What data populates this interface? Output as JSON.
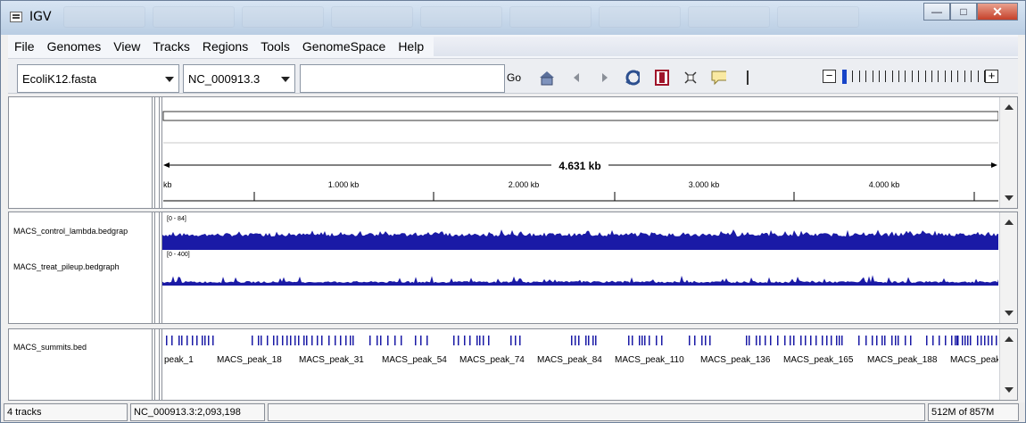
{
  "window": {
    "title": "IGV"
  },
  "menu": [
    "File",
    "Genomes",
    "View",
    "Tracks",
    "Regions",
    "Tools",
    "GenomeSpace",
    "Help"
  ],
  "toolbar": {
    "genome": "EcoliK12.fasta",
    "chromosome": "NC_000913.3",
    "locus": "",
    "go_label": "Go"
  },
  "ruler": {
    "span_label": "4.631 kb",
    "ticks": [
      "kb",
      "1.000 kb",
      "2.000 kb",
      "3.000 kb",
      "4.000 kb"
    ]
  },
  "tracks": [
    {
      "name": "MACS_control_lambda.bedgrap",
      "range": "[0 - 84]"
    },
    {
      "name": "MACS_treat_pileup.bedgraph",
      "range": "[0 - 400]"
    }
  ],
  "feature_track": {
    "name": "MACS_summits.bed",
    "labels": [
      "peak_1",
      "MACS_peak_18",
      "MACS_peak_31",
      "MACS_peak_54",
      "MACS_peak_74",
      "MACS_peak_84",
      "MACS_peak_110",
      "MACS_peak_136",
      "MACS_peak_165",
      "MACS_peak_188",
      "MACS_peak"
    ]
  },
  "status": {
    "track_count": "4 tracks",
    "position": "NC_000913.3:2,093,198",
    "message": "",
    "memory": "512M of 857M"
  },
  "colors": {
    "track_fill": "#1a1aa6",
    "accent": "#1744c8"
  }
}
